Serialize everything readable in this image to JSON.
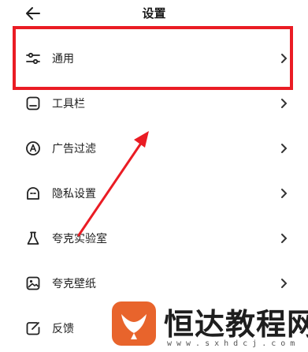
{
  "header": {
    "title": "设置"
  },
  "items": [
    {
      "label": "通用",
      "icon": "sliders-icon"
    },
    {
      "label": "工具栏",
      "icon": "toolbar-icon"
    },
    {
      "label": "广告过滤",
      "icon": "ad-filter-icon"
    },
    {
      "label": "隐私设置",
      "icon": "privacy-icon"
    },
    {
      "label": "夸克实验室",
      "icon": "flask-icon"
    },
    {
      "label": "夸克壁纸",
      "icon": "wallpaper-icon"
    },
    {
      "label": "反馈",
      "icon": "feedback-icon"
    }
  ],
  "annotation": {
    "highlight_color": "#ea1c24"
  },
  "watermark": {
    "text": "恒达教程网",
    "url": "www.sxhdcj.com",
    "color": "#e8642c"
  }
}
